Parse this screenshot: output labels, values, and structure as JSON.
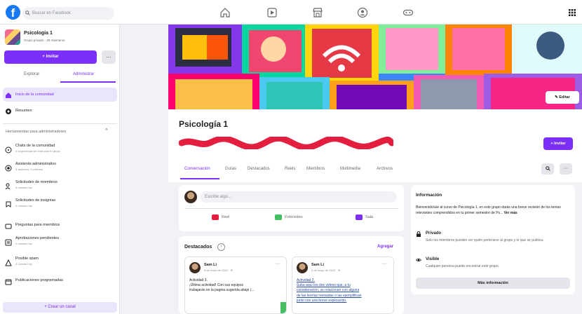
{
  "topbar": {
    "logo": "f",
    "search_placeholder": "Buscar en Facebook",
    "nav_icons": [
      "home-icon",
      "video-icon",
      "marketplace-icon",
      "groups-icon",
      "gaming-icon"
    ],
    "menu_icon": "grid-icon"
  },
  "sidebar": {
    "group_name": "Psicología 1",
    "group_meta": "Grupo privado · 28 miembros",
    "invite_label": "+ Invitar",
    "more_label": "···",
    "tabs": [
      {
        "label": "Explorar"
      },
      {
        "label": "Administrar"
      }
    ],
    "menu": [
      {
        "label": "Inicio de la comunidad",
        "icon": "home-icon"
      },
      {
        "label": "Resumen",
        "icon": "overview-icon"
      }
    ],
    "admin_tools_heading": "Herramientas para administradores",
    "admin_tools_chevron": "^",
    "admin_tools": [
      {
        "title": "Chats de la comunidad",
        "subtitle": "4 sugerencias de chat para tu grupo",
        "icon": "chat-icon"
      },
      {
        "title": "Asistente administrativo",
        "subtitle": "6 acciones, 4 criterios",
        "icon": "assistant-icon"
      },
      {
        "title": "Solicitudes de miembros",
        "subtitle": "0 nuevas hoy",
        "icon": "member-requests-icon"
      },
      {
        "title": "Solicitudes de insignias",
        "subtitle": "0 nuevas hoy",
        "icon": "badge-icon"
      },
      {
        "title": "Preguntas para miembros",
        "subtitle": "",
        "icon": "questions-icon"
      },
      {
        "title": "Aprobaciones pendientes",
        "subtitle": "0 nuevas hoy",
        "icon": "pending-icon"
      },
      {
        "title": "Posible spam",
        "subtitle": "0 nuevas hoy",
        "icon": "spam-icon"
      },
      {
        "title": "Publicaciones programadas",
        "subtitle": "",
        "icon": "scheduled-icon"
      }
    ],
    "create_channel": "+ Crear un canal"
  },
  "header": {
    "edit_cover": "Editar",
    "title": "Psicología 1",
    "invite_label": "+ Invitar",
    "tabs": [
      {
        "label": "Conversación"
      },
      {
        "label": "Guías"
      },
      {
        "label": "Destacados"
      },
      {
        "label": "Reels"
      },
      {
        "label": "Miembros"
      },
      {
        "label": "Multimedia"
      },
      {
        "label": "Archivos"
      }
    ],
    "search_icon": "search-icon",
    "more_label": "···"
  },
  "composer": {
    "placeholder": "Escribe algo...",
    "actions": [
      {
        "label": "Reel",
        "color": "#e41e3f"
      },
      {
        "label": "Foto/video",
        "color": "#45bd62"
      },
      {
        "label": "Sala",
        "color": "#7b2ff7"
      }
    ]
  },
  "featured": {
    "title": "Destacados",
    "add_label": "Agregar",
    "info_icon": "i",
    "posts": [
      {
        "author": "Sam Li",
        "date": "8 de mayo de 2022 · ⊕",
        "dots": "···",
        "lines": [
          "Actividad 3.",
          "¡Última actividad! Con sus equipos",
          "trabajarán en la pagina sugerida abajo (..."
        ],
        "link": false
      },
      {
        "author": "Sam Li",
        "date": "8 de mayo de 2022 · ⊕",
        "dots": "···",
        "lines": [
          "Actividad 2.",
          "Suba aquí los dos videos que, a tu",
          "consideración, se relacionan con alguna",
          "de las teorías revisadas o las ejemplifican",
          "junto con una breve explicación."
        ],
        "link": true
      }
    ]
  },
  "info": {
    "title": "Información",
    "description": "Bienvenido/a/e al curso de Psicología 1, en este grupo darás una breve revisión de los temas relevantes comprendidos en tu primer semestre de Ps...",
    "see_more": "Ver más",
    "private_title": "Privado",
    "private_text": "Solo los miembros pueden ver quién pertenece al grupo y lo que se publica.",
    "visible_title": "Visible",
    "visible_text": "Cualquier persona puede encontrar este grupo.",
    "more_info": "Más información"
  },
  "colors": {
    "accent": "#7b2ff7",
    "fb_blue": "#1877f2",
    "redaction": "#e41e3f"
  }
}
